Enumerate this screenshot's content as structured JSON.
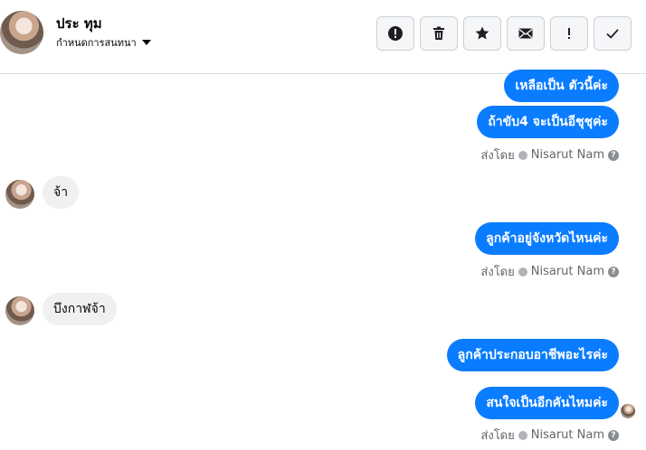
{
  "header": {
    "contact_name": "ประ ทุม",
    "subtitle": "กำหนดการสนทนา"
  },
  "toolbar": {
    "buttons": [
      {
        "name": "report-button",
        "icon": "alert-circle-icon"
      },
      {
        "name": "delete-button",
        "icon": "trash-icon"
      },
      {
        "name": "star-button",
        "icon": "star-icon"
      },
      {
        "name": "mail-button",
        "icon": "envelope-icon"
      },
      {
        "name": "exclamation-button",
        "icon": "exclamation-icon"
      },
      {
        "name": "done-button",
        "icon": "checkmark-icon"
      }
    ]
  },
  "messages": [
    {
      "dir": "out",
      "text": "เหลือเป็น ตัวนี้ค่ะ"
    },
    {
      "dir": "out",
      "text": "ถ้าขับ4 จะเป็นอีชุชุค่ะ"
    },
    {
      "dir": "in",
      "text": "จ้า"
    },
    {
      "dir": "out",
      "text": "ลูกค้าอยู่จังหวัดไหนค่ะ"
    },
    {
      "dir": "in",
      "text": "บึงกาฬจ้า"
    },
    {
      "dir": "out",
      "text": "ลูกค้าประกอบอาชีพอะไรค่ะ"
    },
    {
      "dir": "out",
      "text": "สนใจเป็นอีกคันไหมค่ะ"
    }
  ],
  "sent_by": {
    "prefix": "ส่งโดย",
    "name": "Nisarut Nam",
    "help": "?"
  },
  "colors": {
    "outgoing_bubble": "#0a7cff",
    "incoming_bubble": "#f0f0f0",
    "meta_text": "#65676b"
  }
}
